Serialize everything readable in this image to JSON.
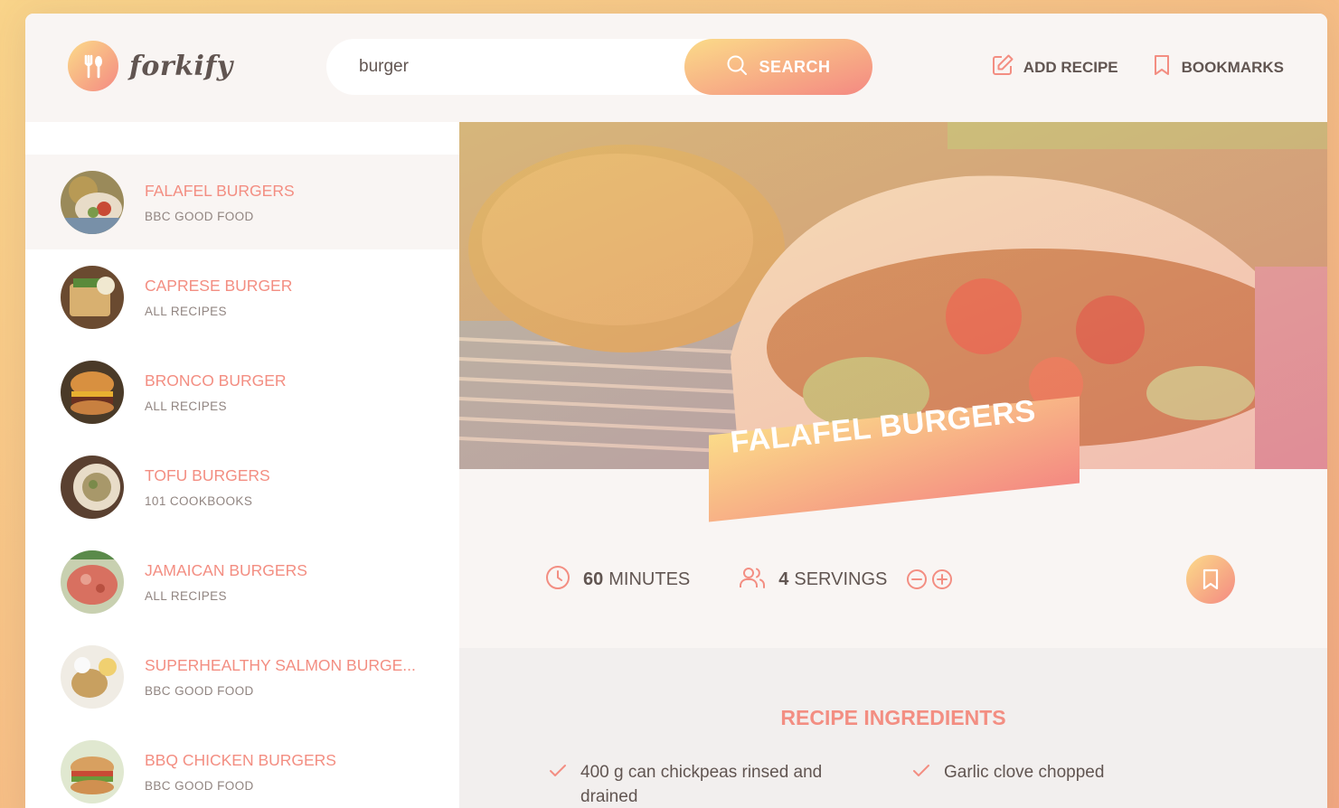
{
  "app": {
    "logo_text": "forkify"
  },
  "search": {
    "value": "burger",
    "button_label": "SEARCH"
  },
  "nav": {
    "add_recipe": "ADD RECIPE",
    "bookmarks": "BOOKMARKS"
  },
  "results": [
    {
      "title": "FALAFEL BURGERS",
      "publisher": "BBC GOOD FOOD",
      "active": true
    },
    {
      "title": "CAPRESE BURGER",
      "publisher": "ALL RECIPES"
    },
    {
      "title": "BRONCO BURGER",
      "publisher": "ALL RECIPES"
    },
    {
      "title": "TOFU BURGERS",
      "publisher": "101 COOKBOOKS"
    },
    {
      "title": "JAMAICAN BURGERS",
      "publisher": "ALL RECIPES"
    },
    {
      "title": "SUPERHEALTHY SALMON BURGE...",
      "publisher": "BBC GOOD FOOD"
    },
    {
      "title": "BBQ CHICKEN BURGERS",
      "publisher": "BBC GOOD FOOD"
    }
  ],
  "recipe": {
    "title": "FALAFEL BURGERS",
    "cooking_time": "60",
    "cooking_time_unit": "MINUTES",
    "servings": "4",
    "servings_unit": "SERVINGS",
    "ingredients_heading": "RECIPE INGREDIENTS",
    "ingredients": [
      "400 g can chickpeas rinsed and drained",
      "Garlic clove chopped"
    ]
  },
  "colors": {
    "accent": "#f38e82",
    "gradient_start": "#fbdb89",
    "gradient_end": "#f48982"
  }
}
